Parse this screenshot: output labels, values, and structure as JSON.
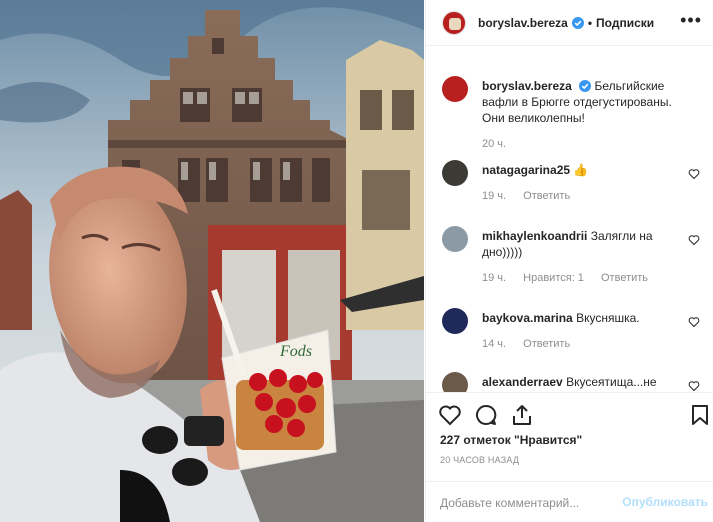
{
  "post": {
    "username": "boryslav.bereza",
    "follow_label": "Подписки",
    "dot": "•",
    "more_label": "•••",
    "image_text": "Fods",
    "caption_text": "Бельгийские вафли в Брюгге отдегустированы. Они великолепны!",
    "caption_time": "20 ч.",
    "likes": "227 отметок \"Нравится\"",
    "posted": "20 ЧАСОВ НАЗАД",
    "comment_placeholder": "Добавьте комментарий...",
    "publish_label": "Опубликовать"
  },
  "comments": [
    {
      "user": "natagagarina25",
      "text": "👍",
      "time": "19 ч.",
      "likes": "",
      "reply": "Ответить"
    },
    {
      "user": "mikhaylenkoandrii",
      "text": "Залягли на дно)))))",
      "time": "19 ч.",
      "likes": "Нравится: 1",
      "reply": "Ответить"
    },
    {
      "user": "baykova.marina",
      "text": "Вкусняшка.",
      "time": "14 ч.",
      "likes": "",
      "reply": "Ответить"
    },
    {
      "user": "alexanderraev",
      "text": "Вкусеятища...не",
      "time": "",
      "likes": "",
      "reply": ""
    }
  ],
  "icons": [
    "verified-icon",
    "heart-icon",
    "comment-icon",
    "share-icon",
    "bookmark-icon"
  ],
  "colors": {
    "verified": "#3897f0",
    "publish": "#b2dffc",
    "meta": "#8e8e8e",
    "avatar": "#b81f1f"
  }
}
